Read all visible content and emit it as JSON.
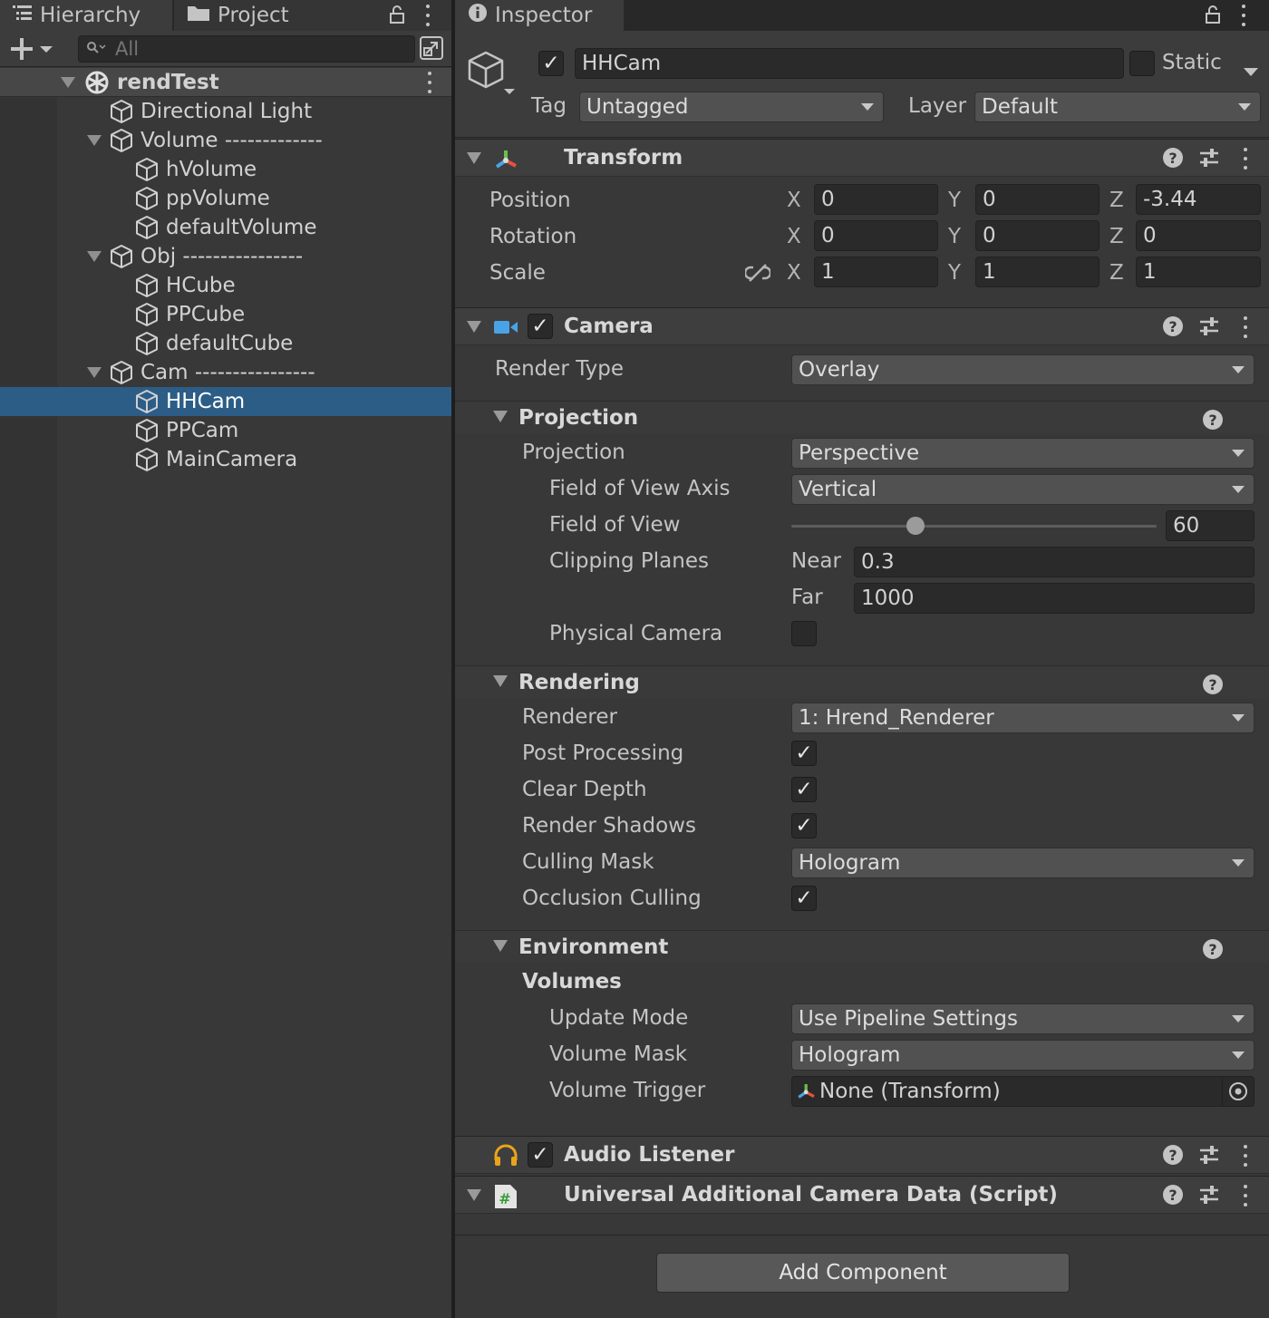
{
  "left": {
    "tabs": [
      {
        "label": "Hierarchy"
      },
      {
        "label": "Project"
      }
    ],
    "search": {
      "placeholder": "All"
    },
    "scene": {
      "name": "rendTest"
    },
    "tree": [
      {
        "label": "Directional Light"
      },
      {
        "label": "Volume -------------"
      },
      {
        "label": "hVolume"
      },
      {
        "label": "ppVolume"
      },
      {
        "label": "defaultVolume"
      },
      {
        "label": "Obj ----------------"
      },
      {
        "label": "HCube"
      },
      {
        "label": "PPCube"
      },
      {
        "label": "defaultCube"
      },
      {
        "label": "Cam ----------------"
      },
      {
        "label": "HHCam"
      },
      {
        "label": "PPCam"
      },
      {
        "label": "MainCamera"
      }
    ]
  },
  "inspector": {
    "tab": "Inspector",
    "object": {
      "name": "HHCam",
      "static_label": "Static",
      "tag_label": "Tag",
      "tag_value": "Untagged",
      "layer_label": "Layer",
      "layer_value": "Default"
    },
    "transform": {
      "title": "Transform",
      "position_label": "Position",
      "rotation_label": "Rotation",
      "scale_label": "Scale",
      "axis_x": "X",
      "axis_y": "Y",
      "axis_z": "Z",
      "position": {
        "x": "0",
        "y": "0",
        "z": "-3.44"
      },
      "rotation": {
        "x": "0",
        "y": "0",
        "z": "0"
      },
      "scale": {
        "x": "1",
        "y": "1",
        "z": "1"
      }
    },
    "camera": {
      "title": "Camera",
      "render_type_label": "Render Type",
      "render_type_value": "Overlay",
      "projection_section": "Projection",
      "projection_label": "Projection",
      "projection_value": "Perspective",
      "fov_axis_label": "Field of View Axis",
      "fov_axis_value": "Vertical",
      "fov_label": "Field of View",
      "fov_value": "60",
      "fov_slider_fraction": 0.34,
      "clipping_label": "Clipping Planes",
      "near_label": "Near",
      "near_value": "0.3",
      "far_label": "Far",
      "far_value": "1000",
      "physical_label": "Physical Camera",
      "rendering_section": "Rendering",
      "renderer_label": "Renderer",
      "renderer_value": "1: Hrend_Renderer",
      "post_processing_label": "Post Processing",
      "clear_depth_label": "Clear Depth",
      "render_shadows_label": "Render Shadows",
      "culling_mask_label": "Culling Mask",
      "culling_mask_value": "Hologram",
      "occlusion_label": "Occlusion Culling",
      "environment_section": "Environment",
      "volumes_label": "Volumes",
      "update_mode_label": "Update Mode",
      "update_mode_value": "Use Pipeline Settings",
      "volume_mask_label": "Volume Mask",
      "volume_mask_value": "Hologram",
      "volume_trigger_label": "Volume Trigger",
      "volume_trigger_value": "None (Transform)"
    },
    "audio_listener": {
      "title": "Audio Listener"
    },
    "ucad": {
      "title": "Universal Additional Camera Data (Script)"
    },
    "add_component": "Add Component"
  },
  "colors": {
    "selection": "#2c5d87",
    "panel": "#383838",
    "field": "#2a2a2a",
    "dropdown": "#515151",
    "audio_icon": "#e8a51b",
    "camera_icon": "#4aa3e6"
  }
}
